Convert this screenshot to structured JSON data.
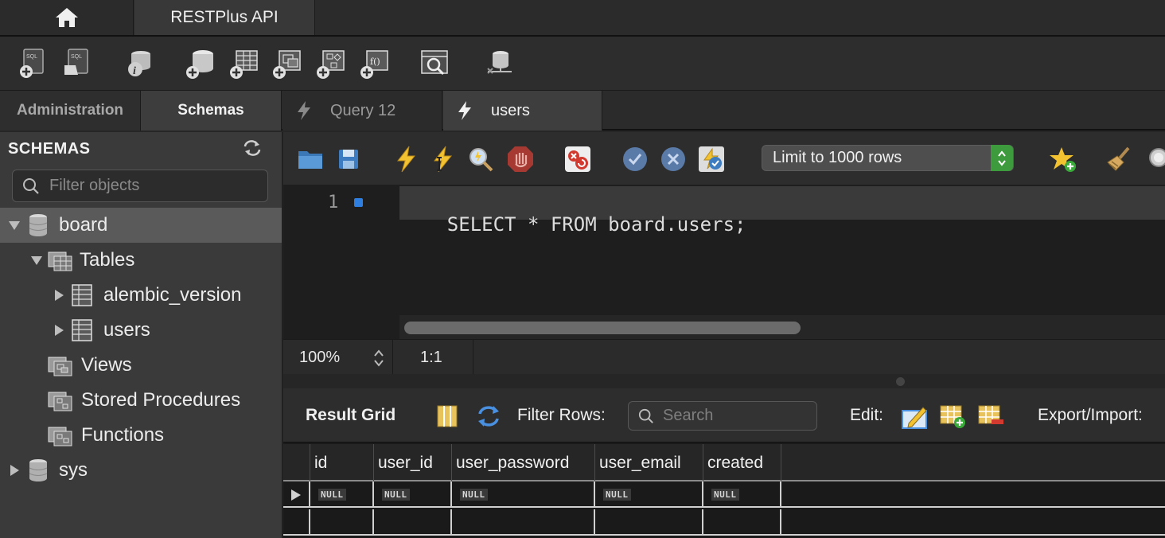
{
  "top_tabs": {
    "home_icon": "home-icon",
    "connection_title": "RESTPlus API"
  },
  "main_toolbar": {
    "icons": [
      "new-sql-tab-icon",
      "open-sql-script-icon",
      "schema-inspector-icon",
      "create-schema-icon",
      "create-table-icon",
      "create-view-icon",
      "create-procedure-icon",
      "create-function-icon",
      "search-table-data-icon",
      "reconnect-icon"
    ]
  },
  "side_tabs": {
    "administration": "Administration",
    "schemas": "Schemas"
  },
  "query_tabs": [
    {
      "label": "Query 12",
      "active": false
    },
    {
      "label": "users",
      "active": true
    }
  ],
  "sidebar": {
    "title": "SCHEMAS",
    "filter_placeholder": "Filter objects",
    "tree": {
      "board": "board",
      "tables": "Tables",
      "alembic_version": "alembic_version",
      "users": "users",
      "views": "Views",
      "stored_procedures": "Stored Procedures",
      "functions": "Functions",
      "sys": "sys"
    }
  },
  "sql_toolbar": {
    "icons": [
      "open-file-icon",
      "save-icon",
      "execute-icon",
      "execute-current-icon",
      "explain-icon",
      "stop-icon",
      "toggle-error-icon",
      "commit-icon",
      "rollback-icon",
      "autocommit-icon",
      "add-snippet-icon",
      "beautify-icon",
      "find-icon"
    ],
    "limit": "Limit to 1000 rows"
  },
  "editor": {
    "line_number": "1",
    "code": "SELECT * FROM board.users;"
  },
  "status": {
    "zoom": "100%",
    "position": "1:1"
  },
  "result_toolbar": {
    "title": "Result Grid",
    "filter_rows": "Filter Rows:",
    "search_placeholder": "Search",
    "edit": "Edit:",
    "export_import": "Export/Import:"
  },
  "grid": {
    "columns": [
      "id",
      "user_id",
      "user_password",
      "user_email",
      "created"
    ],
    "rows": [
      [
        "NULL",
        "NULL",
        "NULL",
        "NULL",
        "NULL"
      ]
    ]
  },
  "colors": {
    "accent_blue": "#2f7fe0",
    "stepper_green": "#3d9a3d",
    "bolt_yellow": "#f2c230"
  }
}
